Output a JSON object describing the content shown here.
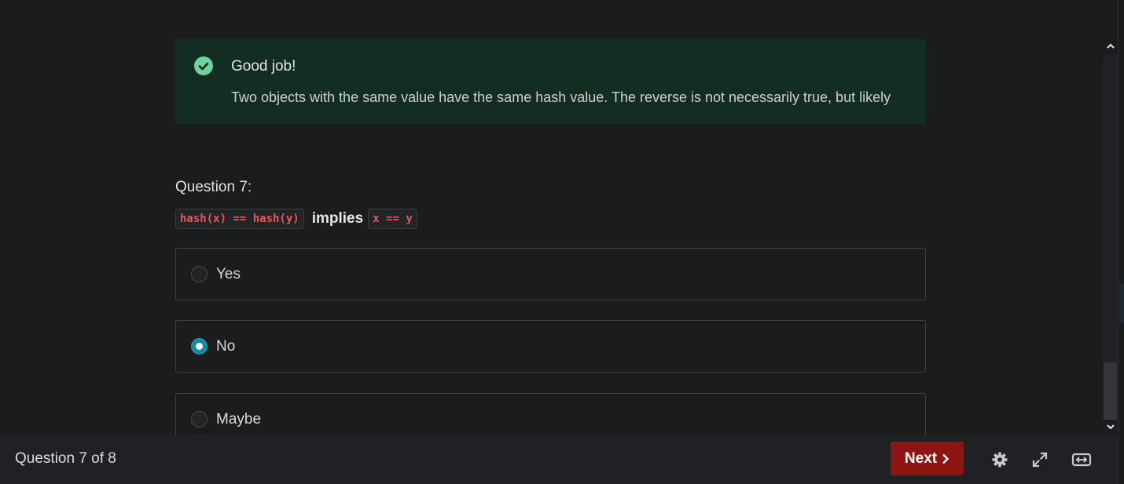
{
  "feedback": {
    "icon": "check-circle-icon",
    "title": "Good job!",
    "message": "Two objects with the same value have the same hash value. The reverse is not necessarily true, but likely",
    "color": "#132d22"
  },
  "question": {
    "label": "Question 7:",
    "code_left": "hash(x) == hash(y)",
    "connector": "implies",
    "code_right": "x == y"
  },
  "options": [
    {
      "label": "Yes",
      "selected": false
    },
    {
      "label": "No",
      "selected": true
    },
    {
      "label": "Maybe",
      "selected": false
    }
  ],
  "footer": {
    "progress": "Question 7 of 8",
    "next_label": "Next",
    "next_color": "#8f1515",
    "tools": [
      "gear-icon",
      "expand-icon",
      "fit-width-icon"
    ]
  }
}
